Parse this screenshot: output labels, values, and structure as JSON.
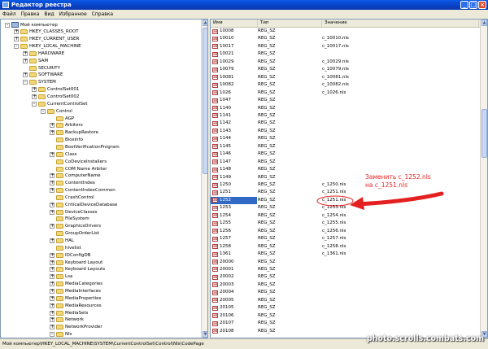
{
  "window": {
    "title": "Редактор реестра",
    "controls": [
      "_",
      "□",
      "×"
    ]
  },
  "menu": [
    "Файл",
    "Правка",
    "Вид",
    "Избранное",
    "Справка"
  ],
  "tree": [
    {
      "label": "Мой компьютер",
      "level": 0,
      "exp": "-",
      "icon": "computer"
    },
    {
      "label": "HKEY_CLASSES_ROOT",
      "level": 1,
      "exp": "+"
    },
    {
      "label": "HKEY_CURRENT_USER",
      "level": 1,
      "exp": "+"
    },
    {
      "label": "HKEY_LOCAL_MACHINE",
      "level": 1,
      "exp": "-"
    },
    {
      "label": "HARDWARE",
      "level": 2,
      "exp": "+"
    },
    {
      "label": "SAM",
      "level": 2,
      "exp": "+"
    },
    {
      "label": "SECURITY",
      "level": 2,
      "exp": ""
    },
    {
      "label": "SOFTWARE",
      "level": 2,
      "exp": "+"
    },
    {
      "label": "SYSTEM",
      "level": 2,
      "exp": "-"
    },
    {
      "label": "ControlSet001",
      "level": 3,
      "exp": "+"
    },
    {
      "label": "ControlSet002",
      "level": 3,
      "exp": "+"
    },
    {
      "label": "CurrentControlSet",
      "level": 3,
      "exp": "-"
    },
    {
      "label": "Control",
      "level": 4,
      "exp": "-"
    },
    {
      "label": "AGP",
      "level": 5,
      "exp": ""
    },
    {
      "label": "Arbiters",
      "level": 5,
      "exp": "+"
    },
    {
      "label": "BackupRestore",
      "level": 5,
      "exp": "+"
    },
    {
      "label": "Biosinfo",
      "level": 5,
      "exp": ""
    },
    {
      "label": "BootVerificationProgram",
      "level": 5,
      "exp": ""
    },
    {
      "label": "Class",
      "level": 5,
      "exp": "+"
    },
    {
      "label": "CoDeviceInstallers",
      "level": 5,
      "exp": ""
    },
    {
      "label": "COM Name Arbiter",
      "level": 5,
      "exp": ""
    },
    {
      "label": "ComputerName",
      "level": 5,
      "exp": "+"
    },
    {
      "label": "ContentIndex",
      "level": 5,
      "exp": "+"
    },
    {
      "label": "ContentIndexCommon",
      "level": 5,
      "exp": "+"
    },
    {
      "label": "CrashControl",
      "level": 5,
      "exp": ""
    },
    {
      "label": "CriticalDeviceDatabase",
      "level": 5,
      "exp": "+"
    },
    {
      "label": "DeviceClasses",
      "level": 5,
      "exp": "+"
    },
    {
      "label": "FileSystem",
      "level": 5,
      "exp": ""
    },
    {
      "label": "GraphicsDrivers",
      "level": 5,
      "exp": "+"
    },
    {
      "label": "GroupOrderList",
      "level": 5,
      "exp": ""
    },
    {
      "label": "HAL",
      "level": 5,
      "exp": "+"
    },
    {
      "label": "hivelist",
      "level": 5,
      "exp": ""
    },
    {
      "label": "IDConfigDB",
      "level": 5,
      "exp": "+"
    },
    {
      "label": "Keyboard Layout",
      "level": 5,
      "exp": "+"
    },
    {
      "label": "Keyboard Layouts",
      "level": 5,
      "exp": "+"
    },
    {
      "label": "Lsa",
      "level": 5,
      "exp": "+"
    },
    {
      "label": "MediaCategories",
      "level": 5,
      "exp": "+"
    },
    {
      "label": "MediaInterfaces",
      "level": 5,
      "exp": "+"
    },
    {
      "label": "MediaProperties",
      "level": 5,
      "exp": "+"
    },
    {
      "label": "MediaResources",
      "level": 5,
      "exp": "+"
    },
    {
      "label": "MediaSets",
      "level": 5,
      "exp": "+"
    },
    {
      "label": "Network",
      "level": 5,
      "exp": "+"
    },
    {
      "label": "NetworkProvider",
      "level": 5,
      "exp": "+"
    },
    {
      "label": "Nls",
      "level": 5,
      "exp": "-"
    }
  ],
  "list": {
    "columns": [
      "Имя",
      "Тип",
      "Значение"
    ],
    "rows": [
      {
        "name": "10008",
        "type": "REG_SZ",
        "value": ""
      },
      {
        "name": "10010",
        "type": "REG_SZ",
        "value": "c_10010.nls"
      },
      {
        "name": "10017",
        "type": "REG_SZ",
        "value": "c_10017.nls"
      },
      {
        "name": "10021",
        "type": "REG_SZ",
        "value": ""
      },
      {
        "name": "10029",
        "type": "REG_SZ",
        "value": "c_10029.nls"
      },
      {
        "name": "10079",
        "type": "REG_SZ",
        "value": "c_10079.nls"
      },
      {
        "name": "10081",
        "type": "REG_SZ",
        "value": "c_10081.nls"
      },
      {
        "name": "10082",
        "type": "REG_SZ",
        "value": "c_10082.nls"
      },
      {
        "name": "1026",
        "type": "REG_SZ",
        "value": "c_1026.nls"
      },
      {
        "name": "1047",
        "type": "REG_SZ",
        "value": ""
      },
      {
        "name": "1140",
        "type": "REG_SZ",
        "value": ""
      },
      {
        "name": "1141",
        "type": "REG_SZ",
        "value": ""
      },
      {
        "name": "1142",
        "type": "REG_SZ",
        "value": ""
      },
      {
        "name": "1143",
        "type": "REG_SZ",
        "value": ""
      },
      {
        "name": "1144",
        "type": "REG_SZ",
        "value": ""
      },
      {
        "name": "1145",
        "type": "REG_SZ",
        "value": ""
      },
      {
        "name": "1146",
        "type": "REG_SZ",
        "value": ""
      },
      {
        "name": "1147",
        "type": "REG_SZ",
        "value": ""
      },
      {
        "name": "1148",
        "type": "REG_SZ",
        "value": ""
      },
      {
        "name": "1149",
        "type": "REG_SZ",
        "value": ""
      },
      {
        "name": "1250",
        "type": "REG_SZ",
        "value": "c_1250.nls"
      },
      {
        "name": "1251",
        "type": "REG_SZ",
        "value": "c_1251.nls"
      },
      {
        "name": "1252",
        "type": "REG_SZ",
        "value": "c_1251.nls",
        "selected": true
      },
      {
        "name": "1253",
        "type": "REG_SZ",
        "value": "c_1253.nls"
      },
      {
        "name": "1254",
        "type": "REG_SZ",
        "value": "c_1254.nls"
      },
      {
        "name": "1255",
        "type": "REG_SZ",
        "value": "c_1255.nls"
      },
      {
        "name": "1256",
        "type": "REG_SZ",
        "value": "c_1256.nls"
      },
      {
        "name": "1257",
        "type": "REG_SZ",
        "value": "c_1257.nls"
      },
      {
        "name": "1258",
        "type": "REG_SZ",
        "value": "c_1258.nls"
      },
      {
        "name": "1361",
        "type": "REG_SZ",
        "value": "c_1361.nls"
      },
      {
        "name": "20000",
        "type": "REG_SZ",
        "value": ""
      },
      {
        "name": "20001",
        "type": "REG_SZ",
        "value": ""
      },
      {
        "name": "20002",
        "type": "REG_SZ",
        "value": ""
      },
      {
        "name": "20003",
        "type": "REG_SZ",
        "value": ""
      },
      {
        "name": "20004",
        "type": "REG_SZ",
        "value": ""
      },
      {
        "name": "20005",
        "type": "REG_SZ",
        "value": ""
      },
      {
        "name": "20105",
        "type": "REG_SZ",
        "value": ""
      },
      {
        "name": "20106",
        "type": "REG_SZ",
        "value": ""
      },
      {
        "name": "20107",
        "type": "REG_SZ",
        "value": ""
      },
      {
        "name": "20108",
        "type": "REG_SZ",
        "value": ""
      }
    ]
  },
  "annotation": {
    "line1": "Заменить c_1252.nls",
    "line2": "на c_1251.nls",
    "color": "#e52020"
  },
  "status": {
    "path": "Мой компьютер\\HKEY_LOCAL_MACHINE\\SYSTEM\\CurrentControlSet\\Control\\Nls\\CodePage"
  },
  "watermark": "photo.scrolls.combats.com"
}
